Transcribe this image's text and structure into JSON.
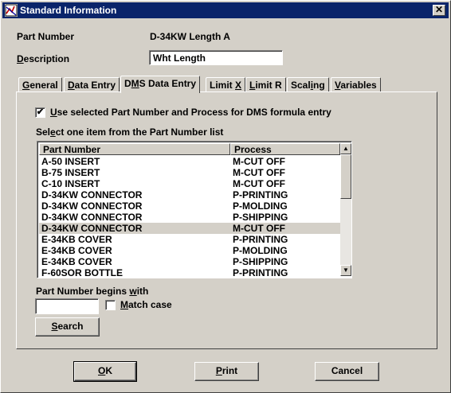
{
  "window": {
    "title": "Standard Information",
    "close_label": "✕"
  },
  "part_number": {
    "label": "Part Number",
    "value": "D-34KW Length A"
  },
  "description": {
    "label_pre": "",
    "label_ul": "D",
    "label_post": "escription",
    "value": "Wht Length"
  },
  "tabs": [
    {
      "pre": "",
      "ul": "G",
      "post": "eneral"
    },
    {
      "pre": "",
      "ul": "D",
      "post": "ata Entry"
    },
    {
      "pre": "D",
      "ul": "M",
      "post": "S Data Entry"
    },
    {
      "pre": "Limit ",
      "ul": "X",
      "post": ""
    },
    {
      "pre": "",
      "ul": "L",
      "post": "imit R"
    },
    {
      "pre": "Scal",
      "ul": "i",
      "post": "ng"
    },
    {
      "pre": "",
      "ul": "V",
      "post": "ariables"
    }
  ],
  "use_selected": {
    "checked": true,
    "check_mark": "✔",
    "label_pre": "",
    "label_ul": "U",
    "label_post": "se selected Part Number and Process for DMS formula entry"
  },
  "list_caption": {
    "pre": "Sel",
    "ul": "e",
    "post": "ct one item from the Part Number list"
  },
  "list": {
    "columns": [
      "Part Number",
      "Process"
    ],
    "rows": [
      {
        "part": "A-50 INSERT",
        "process": "M-CUT OFF"
      },
      {
        "part": "B-75 INSERT",
        "process": "M-CUT OFF"
      },
      {
        "part": "C-10 INSERT",
        "process": "M-CUT OFF"
      },
      {
        "part": "D-34KW CONNECTOR",
        "process": "P-PRINTING"
      },
      {
        "part": "D-34KW CONNECTOR",
        "process": "P-MOLDING"
      },
      {
        "part": "D-34KW CONNECTOR",
        "process": "P-SHIPPING"
      },
      {
        "part": "D-34KW CONNECTOR",
        "process": "M-CUT OFF"
      },
      {
        "part": "E-34KB COVER",
        "process": "P-PRINTING"
      },
      {
        "part": "E-34KB COVER",
        "process": "P-MOLDING"
      },
      {
        "part": "E-34KB COVER",
        "process": "P-SHIPPING"
      },
      {
        "part": "F-60SOR BOTTLE",
        "process": "P-PRINTING"
      }
    ],
    "selected_index": 6,
    "scroll_up": "▲",
    "scroll_down": "▼"
  },
  "begins_with": {
    "pre": "Part Number begins ",
    "ul": "w",
    "post": "ith",
    "value": ""
  },
  "match_case": {
    "checked": false,
    "pre": "",
    "ul": "M",
    "post": "atch case"
  },
  "search_button": {
    "pre": "",
    "ul": "S",
    "post": "earch"
  },
  "buttons": {
    "ok": {
      "pre": "",
      "ul": "O",
      "post": "K"
    },
    "print": {
      "pre": "",
      "ul": "P",
      "post": "rint"
    },
    "cancel": {
      "label": "Cancel"
    }
  }
}
